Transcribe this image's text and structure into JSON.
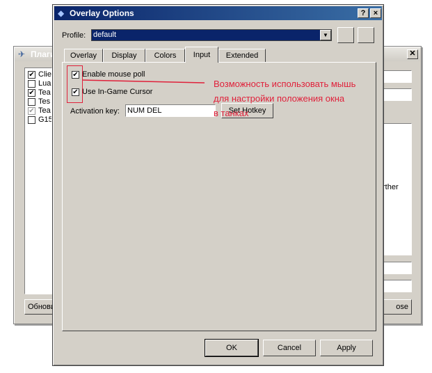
{
  "background_window": {
    "title": "Плаги",
    "plugins": [
      {
        "label": "Clie",
        "checked": true,
        "dim": false
      },
      {
        "label": "Lua",
        "checked": false,
        "dim": false
      },
      {
        "label": "Tea",
        "checked": true,
        "dim": false
      },
      {
        "label": "Tes",
        "checked": false,
        "dim": false
      },
      {
        "label": "Tea",
        "checked": true,
        "dim": true
      },
      {
        "label": "G15",
        "checked": false,
        "dim": false
      }
    ],
    "left_button_label": "Обнови",
    "right_button_label": "ose",
    "right_text_fragment": "rther"
  },
  "dialog": {
    "title": "Overlay Options",
    "help_label": "?",
    "close_label": "×",
    "profile_label": "Profile:",
    "profile_value": "default",
    "tabs": [
      "Overlay",
      "Display",
      "Colors",
      "Input",
      "Extended"
    ],
    "active_tab": "Input",
    "input_tab": {
      "enable_mouse_poll_label": "Enable mouse poll",
      "enable_mouse_poll_checked": true,
      "use_ingame_cursor_label": "Use In-Game Cursor",
      "use_ingame_cursor_checked": true,
      "activation_key_label": "Activation key:",
      "activation_key_value": "NUM DEL",
      "set_hotkey_label": "Set Hotkey"
    },
    "buttons": {
      "ok": "OK",
      "cancel": "Cancel",
      "apply": "Apply"
    }
  },
  "annotation": {
    "lines": [
      "Возможность использовать мышь",
      "для настройки положения окна",
      "в танках"
    ],
    "color": "#e0203a"
  }
}
